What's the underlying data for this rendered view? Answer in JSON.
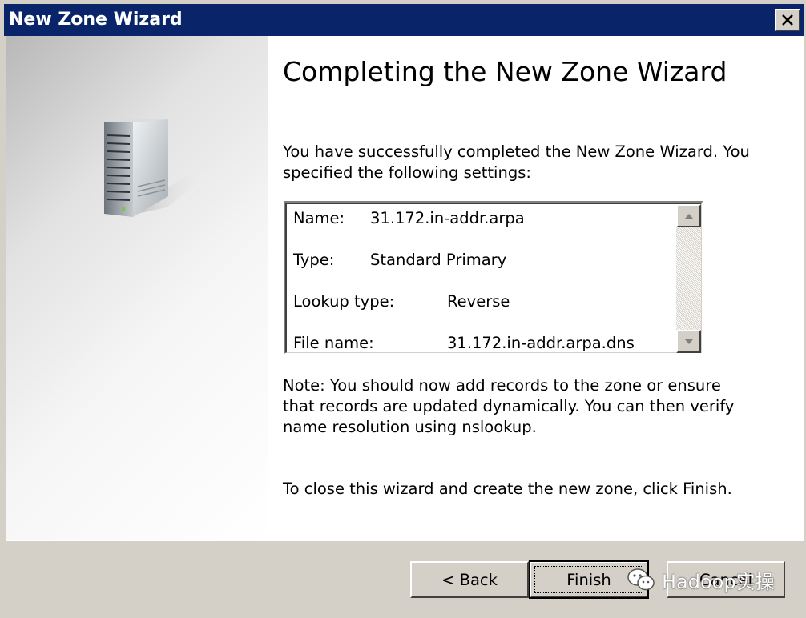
{
  "window": {
    "title": "New Zone Wizard"
  },
  "wizard": {
    "heading": "Completing the New Zone Wizard",
    "intro_line1": "You have successfully completed the New Zone Wizard. You",
    "intro_line2": "specified the following settings:",
    "settings": [
      {
        "label": "Name:",
        "value": "31.172.in-addr.arpa"
      },
      {
        "label": "Type:",
        "value": "Standard Primary"
      },
      {
        "label": "Lookup type:",
        "value": "Reverse"
      },
      {
        "label": "File name:",
        "value": "31.172.in-addr.arpa.dns"
      }
    ],
    "note_line1": "Note: You should now add records to the zone or ensure",
    "note_line2": "that records are updated dynamically. You can then verify",
    "note_line3": "name resolution using nslookup.",
    "close_instruction": "To close this wizard and create the new zone, click Finish."
  },
  "buttons": {
    "back": "< Back",
    "finish": "Finish",
    "cancel": "Cancel"
  },
  "watermark": {
    "text": "Hadoop实操"
  },
  "colors": {
    "titlebar": "#0a246a",
    "dialog_face": "#d4d0c8",
    "content_bg": "#ffffff"
  }
}
